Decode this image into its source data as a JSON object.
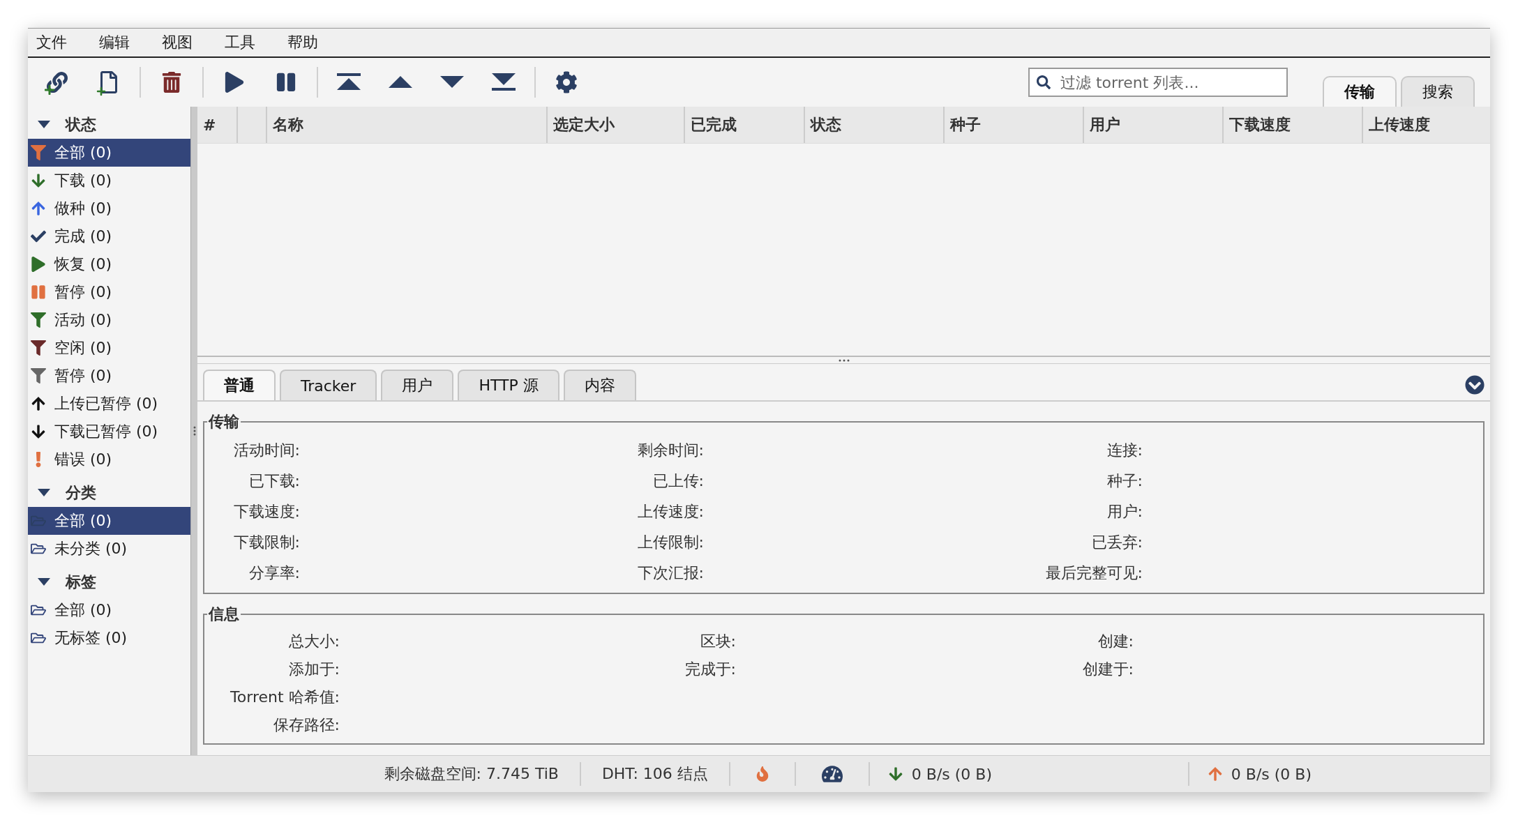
{
  "menu": [
    {
      "label": "文件"
    },
    {
      "label": "编辑"
    },
    {
      "label": "视图"
    },
    {
      "label": "工具"
    },
    {
      "label": "帮助"
    }
  ],
  "search": {
    "placeholder": "过滤 torrent 列表..."
  },
  "main_tabs": [
    {
      "label": "传输",
      "selected": true
    },
    {
      "label": "搜索",
      "selected": false
    }
  ],
  "sidebar": [
    {
      "title": "状态",
      "expanded": true,
      "items": [
        {
          "label": "全部 (0)",
          "selected": true
        },
        {
          "label": "下载 (0)",
          "selected": false
        },
        {
          "label": "做种 (0)",
          "selected": false
        },
        {
          "label": "完成 (0)",
          "selected": false
        },
        {
          "label": "恢复 (0)",
          "selected": false
        },
        {
          "label": "暂停 (0)",
          "selected": false
        },
        {
          "label": "活动 (0)",
          "selected": false
        },
        {
          "label": "空闲 (0)",
          "selected": false
        },
        {
          "label": "暂停 (0)",
          "selected": false
        },
        {
          "label": "上传已暂停 (0)",
          "selected": false
        },
        {
          "label": "下载已暂停 (0)",
          "selected": false
        },
        {
          "label": "错误 (0)",
          "selected": false
        }
      ]
    },
    {
      "title": "分类",
      "expanded": true,
      "items": [
        {
          "label": "全部 (0)",
          "selected": true
        },
        {
          "label": "未分类 (0)",
          "selected": false
        }
      ]
    },
    {
      "title": "标签",
      "expanded": true,
      "items": [
        {
          "label": "全部 (0)",
          "selected": false
        },
        {
          "label": "无标签 (0)",
          "selected": false
        }
      ]
    }
  ],
  "table": {
    "columns": [
      {
        "label": "#"
      },
      {
        "label": "名称"
      },
      {
        "label": "选定大小"
      },
      {
        "label": "已完成"
      },
      {
        "label": "状态"
      },
      {
        "label": "种子"
      },
      {
        "label": "用户"
      },
      {
        "label": "下载速度"
      },
      {
        "label": "上传速度"
      }
    ]
  },
  "detail_tabs": [
    {
      "label": "普通",
      "selected": true
    },
    {
      "label": "Tracker",
      "selected": false
    },
    {
      "label": "用户",
      "selected": false
    },
    {
      "label": "HTTP 源",
      "selected": false
    },
    {
      "label": "内容",
      "selected": false
    }
  ],
  "fieldsets": [
    {
      "title": "传输",
      "rows": [
        [
          "活动时间:",
          "剩余时间:",
          "连接:"
        ],
        [
          "已下载:",
          "已上传:",
          "种子:"
        ],
        [
          "下载速度:",
          "上传速度:",
          "用户:"
        ],
        [
          "下载限制:",
          "上传限制:",
          "已丢弃:"
        ],
        [
          "分享率:",
          "下次汇报:",
          "最后完整可见:"
        ]
      ]
    },
    {
      "title": "信息",
      "rows": [
        [
          "总大小:",
          "区块:",
          "创建:"
        ],
        [
          "添加于:",
          "完成于:",
          "创建于:"
        ],
        [
          "Torrent 哈希值:"
        ],
        [
          "保存路径:"
        ]
      ]
    }
  ],
  "status_bar": {
    "disk": "剩余磁盘空间: 7.745 TiB",
    "dht": "DHT: 106 结点",
    "download": "0 B/s (0 B)",
    "upload": "0 B/s (0 B)"
  }
}
